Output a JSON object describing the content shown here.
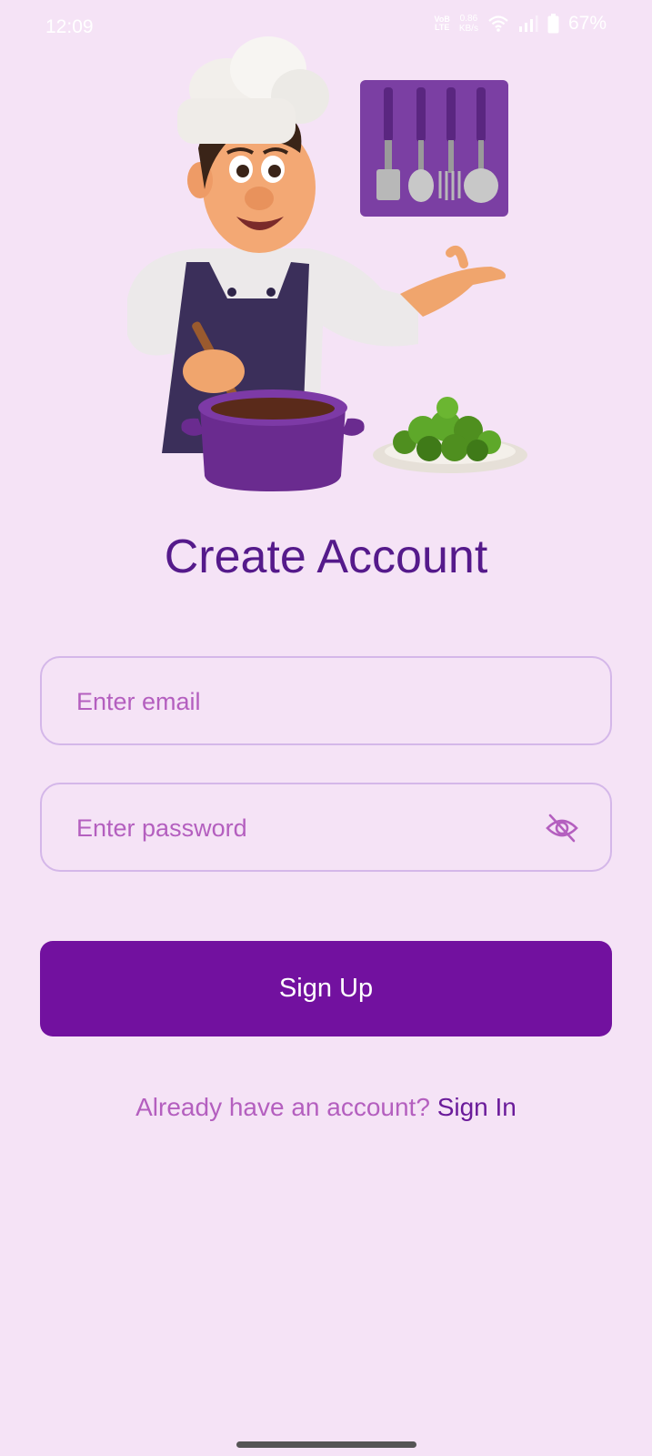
{
  "status_bar": {
    "time": "12:09",
    "network_label_top": "VoB",
    "network_label_bottom": "LTE",
    "speed_value": "0.86",
    "speed_unit": "KB/s",
    "battery_percent": "67%"
  },
  "page": {
    "title": "Create Account"
  },
  "form": {
    "email_placeholder": "Enter email",
    "password_placeholder": "Enter password",
    "submit_label": "Sign Up"
  },
  "footer": {
    "prompt": "Already have an account?",
    "link_label": "Sign In"
  },
  "icons": {
    "password_toggle": "eye-off-icon"
  },
  "colors": {
    "background": "#f5e3f6",
    "title": "#551a8b",
    "primary_button": "#72119f",
    "placeholder": "#b45fbf",
    "field_border": "#d4b7e9",
    "link": "#6a1b9a"
  }
}
